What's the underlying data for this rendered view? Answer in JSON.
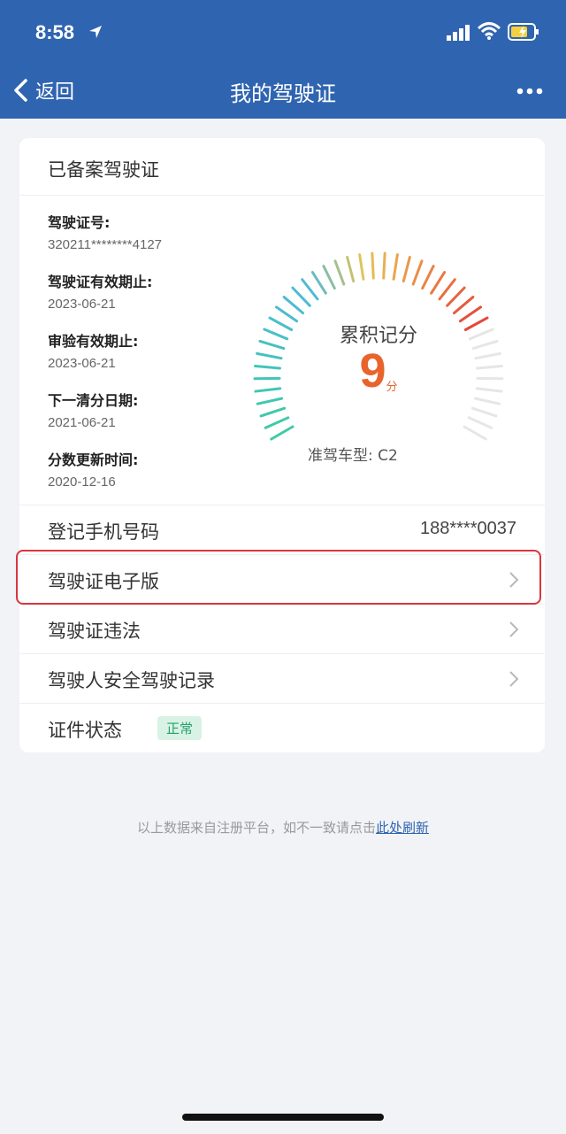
{
  "status_bar": {
    "time": "8:58"
  },
  "nav": {
    "back_label": "返回",
    "title": "我的驾驶证"
  },
  "card": {
    "header": "已备案驾驶证",
    "info": [
      {
        "label": "驾驶证号:",
        "value": "320211********4127"
      },
      {
        "label": "驾驶证有效期止:",
        "value": "2023-06-21"
      },
      {
        "label": "审验有效期止:",
        "value": "2023-06-21"
      },
      {
        "label": "下一清分日期:",
        "value": "2021-06-21"
      },
      {
        "label": "分数更新时间:",
        "value": "2020-12-16"
      }
    ],
    "gauge": {
      "title": "累积记分",
      "score": "9",
      "unit": "分",
      "max": 12,
      "vehicle": "准驾车型: C2"
    },
    "rows": {
      "phone_label": "登记手机号码",
      "phone_value": "188****0037",
      "ecert_label": "驾驶证电子版",
      "violation_label": "驾驶证违法",
      "safety_label": "驾驶人安全驾驶记录",
      "status_label": "证件状态",
      "status_value": "正常"
    }
  },
  "footer": {
    "text": "以上数据来自注册平台，如不一致请点击",
    "link": "此处刷新"
  },
  "colors": {
    "primary": "#2f64b0",
    "score": "#e8642c",
    "highlight": "#d9363e",
    "badge_text": "#27a06a"
  }
}
